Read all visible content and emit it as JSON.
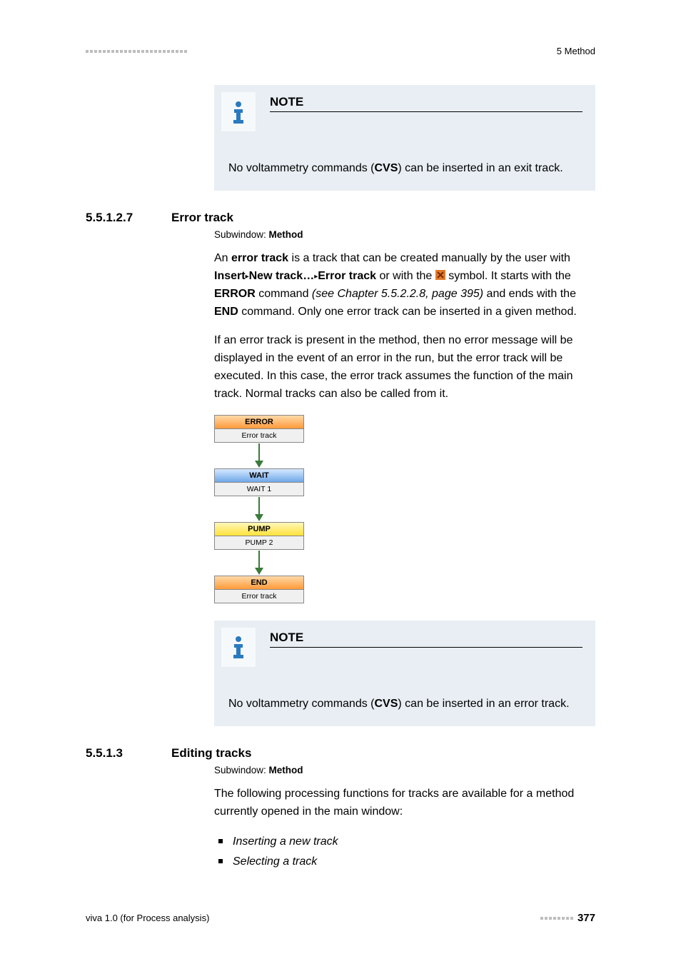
{
  "header": {
    "crumb": "5 Method"
  },
  "note1": {
    "title": "NOTE",
    "body_pre": "No voltammetry commands (",
    "body_bold": "CVS",
    "body_post": ") can be inserted in an exit track."
  },
  "sec1": {
    "num": "5.5.1.2.7",
    "title": "Error track",
    "subwindow_label": "Subwindow: ",
    "subwindow_val": "Method"
  },
  "p1": {
    "t1": "An ",
    "b1": "error track",
    "t2": " is a track that can be created manually by the user with ",
    "b2": "Insert",
    "tri1": " ▸ ",
    "b3": "New track…",
    "tri2": " ▸ ",
    "b4": "Error track",
    "t3": " or with the ",
    "t4": " symbol. It starts with the ",
    "b5": "ERROR",
    "t5": " command ",
    "it1": "(see Chapter 5.5.2.2.8, page 395)",
    "t6": " and ends with the ",
    "b6": "END",
    "t7": " command. Only one error track can be inserted in a given method."
  },
  "p2": "If an error track is present in the method, then no error message will be displayed in the event of an error in the run, but the error track will be executed. In this case, the error track assumes the function of the main track. Normal tracks can also be called from it.",
  "chart_data": {
    "type": "flowchart",
    "nodes": [
      {
        "header": "ERROR",
        "sub": "Error track",
        "color": "orange"
      },
      {
        "header": "WAIT",
        "sub": "WAIT 1",
        "color": "blue"
      },
      {
        "header": "PUMP",
        "sub": "PUMP 2",
        "color": "yellow"
      },
      {
        "header": "END",
        "sub": "Error track",
        "color": "orange"
      }
    ]
  },
  "note2": {
    "title": "NOTE",
    "body_pre": "No voltammetry commands (",
    "body_bold": "CVS",
    "body_post": ") can be inserted in an error track."
  },
  "sec2": {
    "num": "5.5.1.3",
    "title": "Editing tracks",
    "subwindow_label": "Subwindow: ",
    "subwindow_val": "Method"
  },
  "p3": "The following processing functions for tracks are available for a method currently opened in the main window:",
  "bullets": [
    "Inserting a new track",
    "Selecting a track"
  ],
  "footer": {
    "left": "viva 1.0 (for Process analysis)",
    "page": "377"
  }
}
